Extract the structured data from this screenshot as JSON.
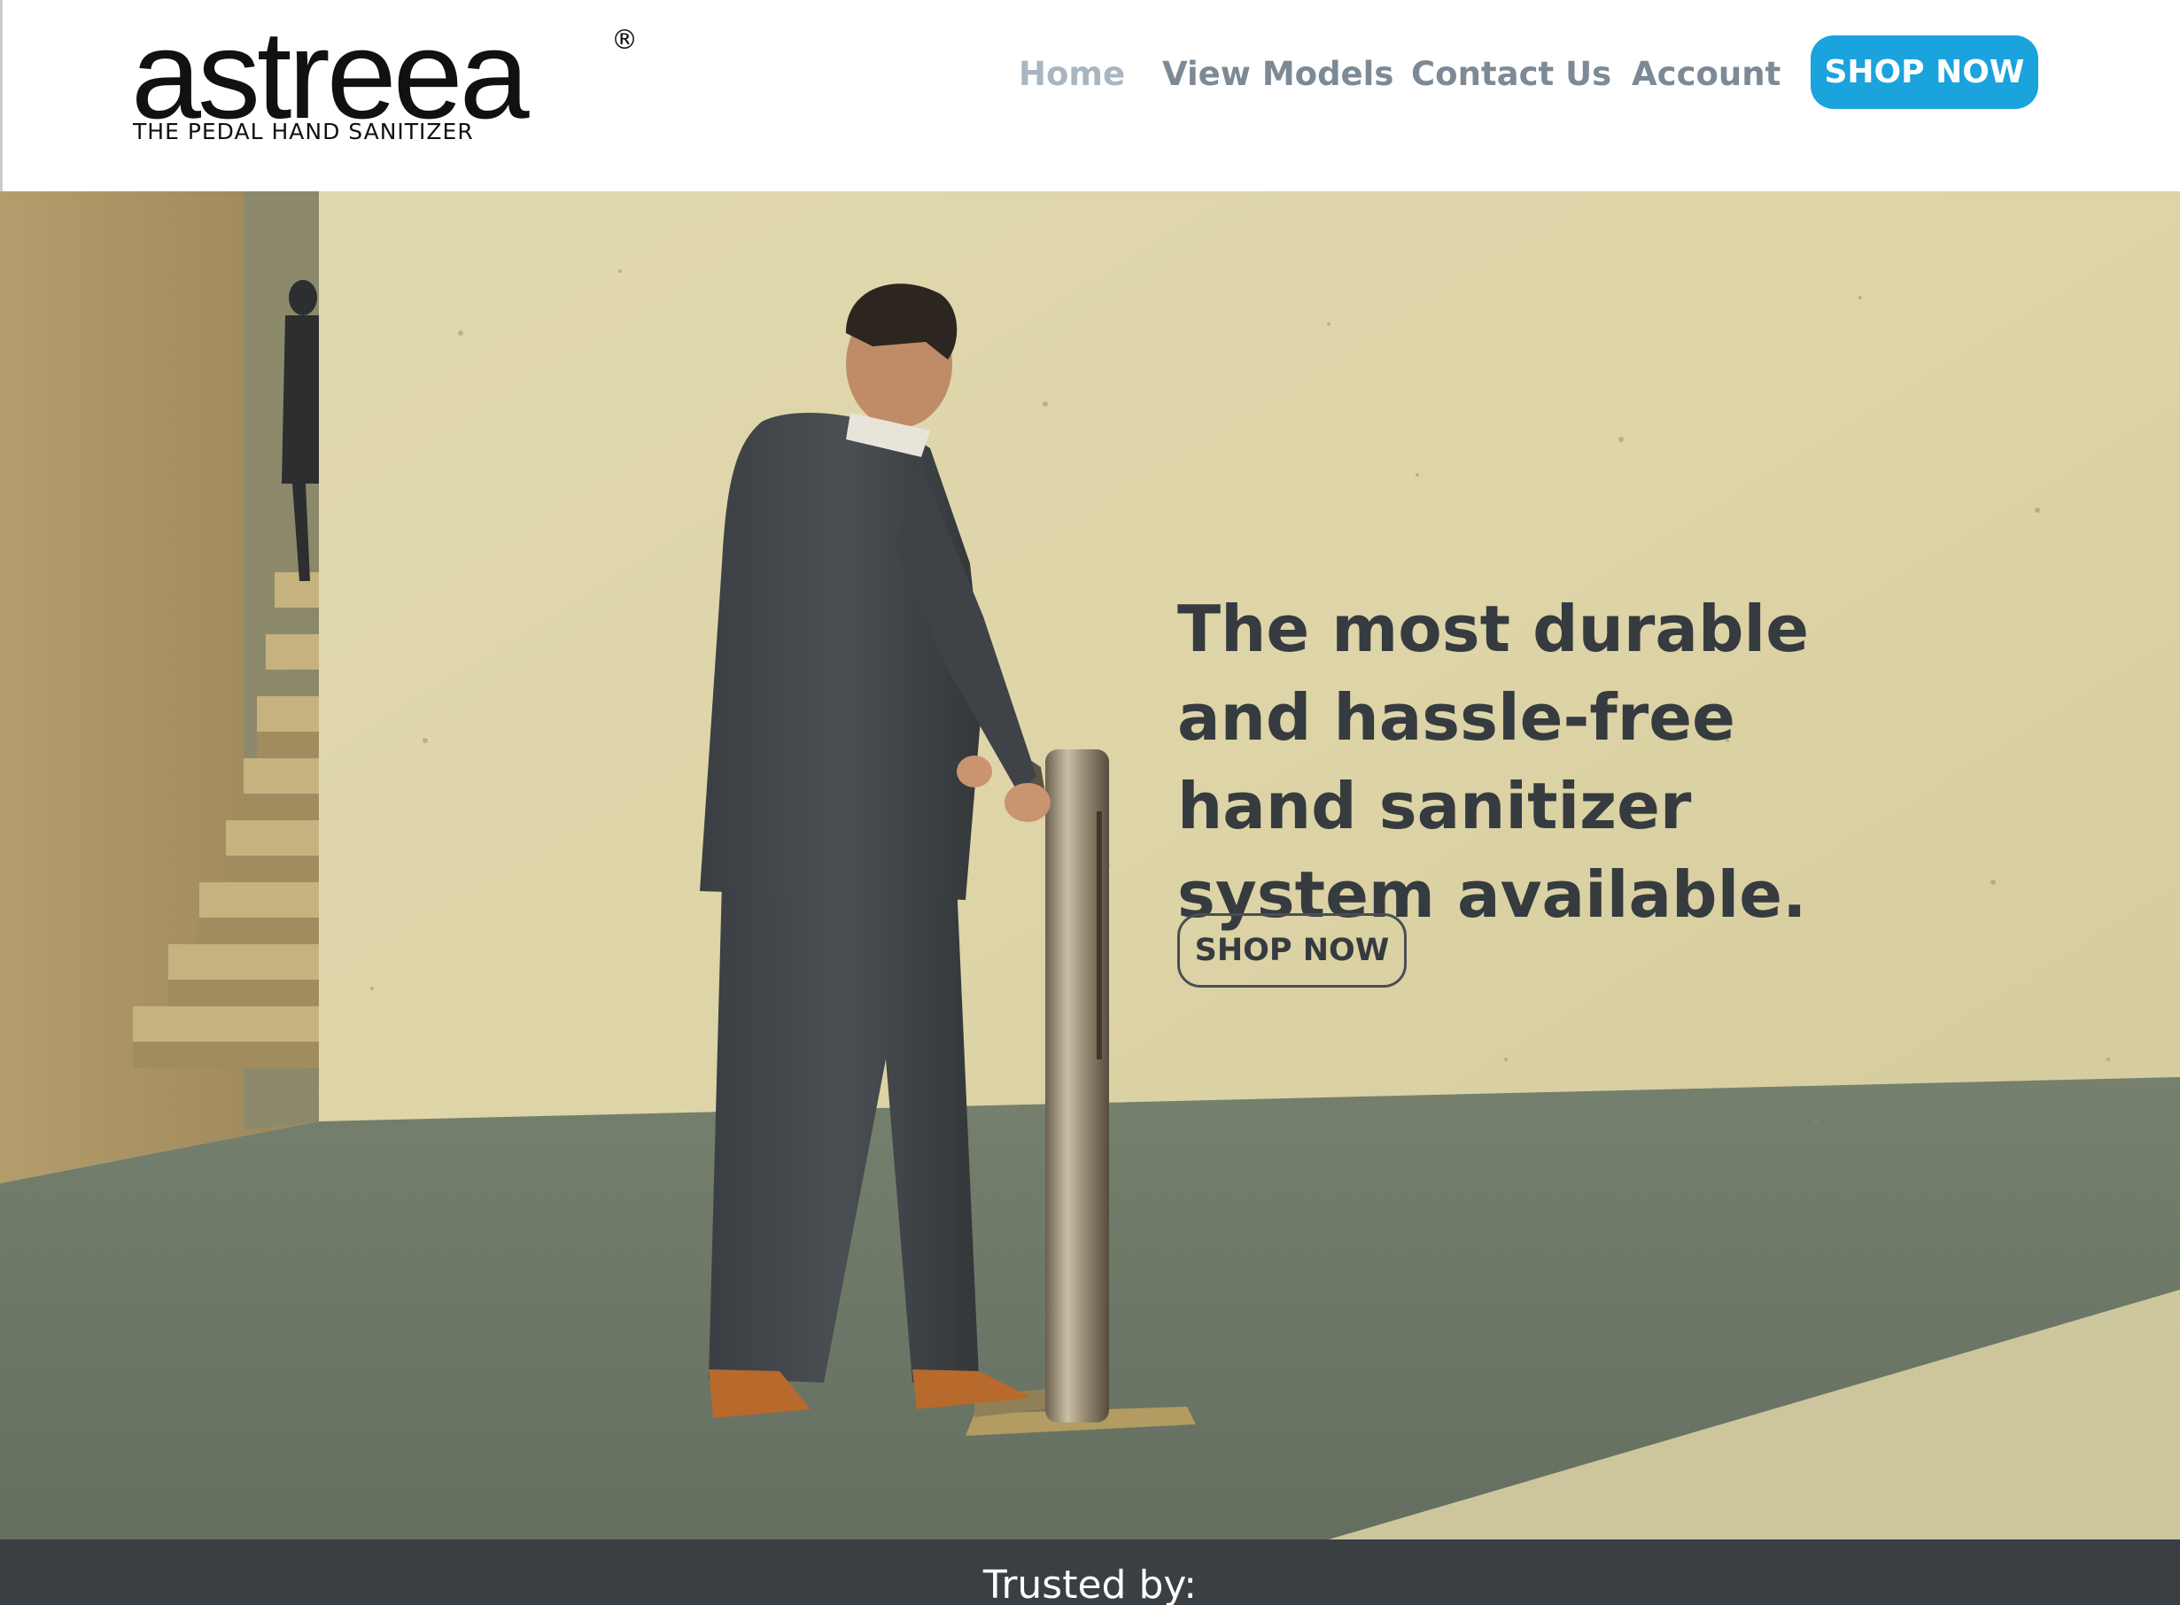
{
  "brand": {
    "name": "astreea",
    "registered_mark": "®",
    "tagline": "THE PEDAL HAND SANITIZER"
  },
  "nav": {
    "items": [
      {
        "label": "Home",
        "active": true
      },
      {
        "label": "View Models",
        "active": false
      },
      {
        "label": "Contact Us",
        "active": false
      },
      {
        "label": "Account",
        "active": false
      }
    ],
    "cta_label": "SHOP NOW"
  },
  "hero": {
    "headline_lines": [
      "The most durable",
      "and hassle-free",
      "hand sanitizer",
      "system available."
    ],
    "cta_label": "SHOP NOW",
    "image": "man-using-pedal-hand-sanitizer-photo"
  },
  "trusted": {
    "label": "Trusted by:"
  },
  "colors": {
    "accent": "#1ba3dd",
    "nav_text": "#7d8a96",
    "nav_active": "#a9b6c1",
    "headline": "#363b40",
    "footer_band": "#3a3f44"
  }
}
